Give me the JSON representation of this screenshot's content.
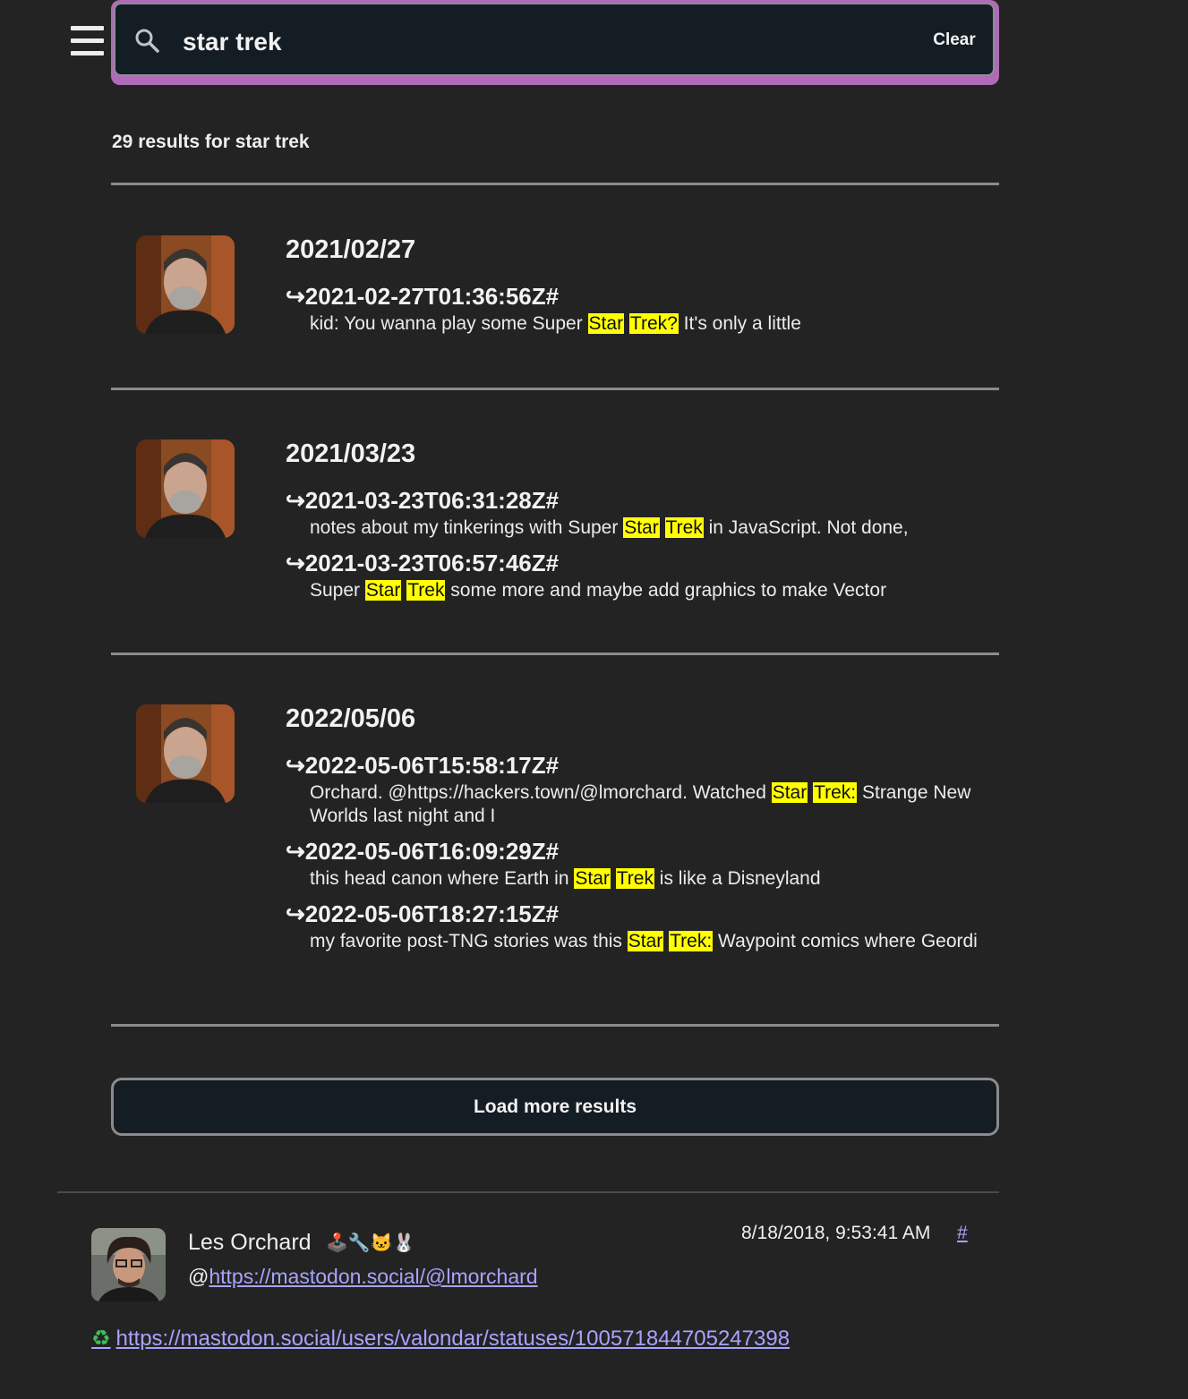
{
  "search": {
    "value": "star trek",
    "clear_label": "Clear"
  },
  "results_summary": "29 results for star trek",
  "groups": [
    {
      "date": "2021/02/27",
      "entries": [
        {
          "timestamp": "2021-02-27T01:36:56Z#",
          "text_parts": [
            {
              "text": "kid: You wanna play some Super ",
              "hl": false
            },
            {
              "text": "Star",
              "hl": true
            },
            {
              "text": " ",
              "hl": false
            },
            {
              "text": "Trek?",
              "hl": true
            },
            {
              "text": " It's only a little",
              "hl": false
            }
          ]
        }
      ]
    },
    {
      "date": "2021/03/23",
      "entries": [
        {
          "timestamp": "2021-03-23T06:31:28Z#",
          "text_parts": [
            {
              "text": "notes about my tinkerings with Super ",
              "hl": false
            },
            {
              "text": "Star",
              "hl": true
            },
            {
              "text": " ",
              "hl": false
            },
            {
              "text": "Trek",
              "hl": true
            },
            {
              "text": " in JavaScript. Not done,",
              "hl": false
            }
          ]
        },
        {
          "timestamp": "2021-03-23T06:57:46Z#",
          "text_parts": [
            {
              "text": "Super ",
              "hl": false
            },
            {
              "text": "Star",
              "hl": true
            },
            {
              "text": " ",
              "hl": false
            },
            {
              "text": "Trek",
              "hl": true
            },
            {
              "text": " some more and maybe add graphics to make Vector",
              "hl": false
            }
          ]
        }
      ]
    },
    {
      "date": "2022/05/06",
      "entries": [
        {
          "timestamp": "2022-05-06T15:58:17Z#",
          "text_parts": [
            {
              "text": "Orchard. @https://hackers.town/@lmorchard. Watched ",
              "hl": false
            },
            {
              "text": "Star",
              "hl": true
            },
            {
              "text": " ",
              "hl": false
            },
            {
              "text": "Trek:",
              "hl": true
            },
            {
              "text": " Strange New Worlds last night and I",
              "hl": false
            }
          ]
        },
        {
          "timestamp": "2022-05-06T16:09:29Z#",
          "text_parts": [
            {
              "text": "this head canon where Earth in ",
              "hl": false
            },
            {
              "text": "Star",
              "hl": true
            },
            {
              "text": " ",
              "hl": false
            },
            {
              "text": "Trek",
              "hl": true
            },
            {
              "text": " is like a Disneyland",
              "hl": false
            }
          ]
        },
        {
          "timestamp": "2022-05-06T18:27:15Z#",
          "text_parts": [
            {
              "text": "my favorite post-TNG stories was this ",
              "hl": false
            },
            {
              "text": "Star",
              "hl": true
            },
            {
              "text": " ",
              "hl": false
            },
            {
              "text": "Trek:",
              "hl": true
            },
            {
              "text": " Waypoint comics where Geordi",
              "hl": false
            }
          ]
        }
      ]
    }
  ],
  "load_more_label": "Load more results",
  "card": {
    "name": "Les Orchard",
    "name_emoji": "🕹️🔧🐱🐰",
    "handle_prefix": "@",
    "handle_link": "https://mastodon.social/@lmorchard",
    "time": "8/18/2018, 9:53:41 AM",
    "hash": "#",
    "boost_icon": "♻",
    "boost_link": "https://mastodon.social/users/valondar/statuses/100571844705247398"
  },
  "colors": {
    "background": "#232323",
    "highlight": "#ffff00",
    "link": "#a8a3ff",
    "focus_ring": "#b06ab8"
  }
}
